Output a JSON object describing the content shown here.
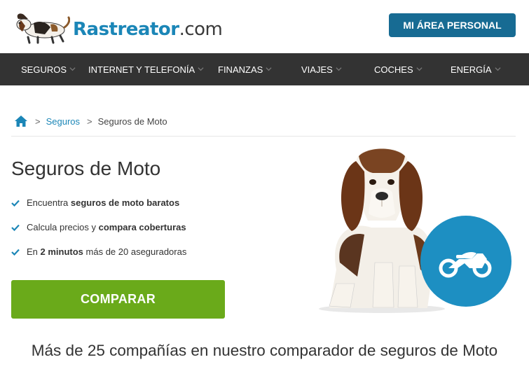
{
  "header": {
    "logo": {
      "brand": "Rastreator",
      "tld": ".com"
    },
    "area_button": "MI ÁREA PERSONAL"
  },
  "nav": {
    "items": [
      {
        "label": "SEGUROS"
      },
      {
        "label": "INTERNET Y TELEFONÍA"
      },
      {
        "label": "FINANZAS"
      },
      {
        "label": "VIAJES"
      },
      {
        "label": "COCHES"
      },
      {
        "label": "ENERGÍA"
      }
    ]
  },
  "breadcrumb": {
    "separator": ">",
    "link": "Seguros",
    "current": "Seguros de Moto"
  },
  "main": {
    "title": "Seguros de Moto",
    "features": [
      {
        "pre": "Encuentra ",
        "bold": "seguros de moto baratos",
        "post": ""
      },
      {
        "pre": "Calcula precios y ",
        "bold": "compara coberturas",
        "post": ""
      },
      {
        "pre": "En ",
        "bold": "2 minutos",
        "post": " más de 20 aseguradoras"
      }
    ],
    "cta": "COMPARAR",
    "subheading": "Más de 25 compañías en nuestro comparador de seguros de Moto"
  },
  "icons": {
    "home": "home-icon",
    "check": "check-icon",
    "chevron": "chevron-down-icon",
    "moto": "motorbike-icon"
  },
  "colors": {
    "brand": "#1b86b7",
    "nav_bg": "#333333",
    "area_button": "#176b93",
    "cta": "#6aaa1a",
    "badge": "#1d8fc2"
  }
}
